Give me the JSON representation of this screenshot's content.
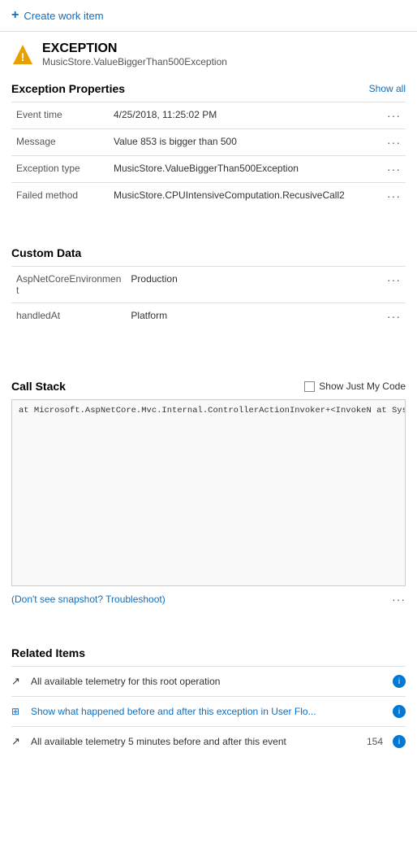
{
  "header": {
    "create_work_item_label": "Create work item",
    "plus_symbol": "+"
  },
  "exception": {
    "title": "EXCEPTION",
    "subtitle": "MusicStore.ValueBiggerThan500Exception"
  },
  "exception_properties": {
    "section_title": "Exception Properties",
    "show_all_label": "Show all",
    "rows": [
      {
        "name": "Event time",
        "value": "4/25/2018, 11:25:02 PM"
      },
      {
        "name": "Message",
        "value": "Value 853 is bigger than 500"
      },
      {
        "name": "Exception type",
        "value": "MusicStore.ValueBiggerThan500Exception"
      },
      {
        "name": "Failed method",
        "value": "MusicStore.CPUIntensiveComputation.RecusiveCall2"
      }
    ],
    "ellipsis": "···"
  },
  "custom_data": {
    "section_title": "Custom Data",
    "rows": [
      {
        "name": "AspNetCoreEnvironmen\nt",
        "value": "Production"
      },
      {
        "name": "handledAt",
        "value": "Platform"
      }
    ],
    "ellipsis": "···"
  },
  "call_stack": {
    "section_title": "Call Stack",
    "show_just_code_label": "Show Just My Code",
    "stack_text": "   at Microsoft.AspNetCore.Mvc.Internal.ControllerActionInvoker+<InvokeN\n   at System.Runtime.ExceptionServices.ExceptionDispatchInfo.Throw (Sys^\n   at System.Runtime.CompilerServices.TaskAwaiter.ThrowForNonSuccess (S\n   at Microsoft.AspNetCore.Mvc.Internal.ControllerActionInvoker+<Invoke\n   at System.Runtime.ExceptionServices.ExceptionDispatchInfo.Throw (Sys\n   at Microsoft.AspNetCore.Mvc.Internal.ControllerActionInvoker.Rethrow\n   at Microsoft.AspNetCore.Mvc.Internal.ControllerActionInvoker.Next (M\n   at Microsoft.AspNetCore.Mvc.Internal.ControllerActionInvoker+<Invoke\n   at System.Runtime.CompilerServices.TaskAwaiter.ThrowForNonSuccess (S\n   at Microsoft.AspNetCore.Mvc.Internal.ResourceInvoker+<InvokeNextResd\n   at System.Runtime.ExceptionServices.ExceptionDispatchInfo.Throw (Sys\n   at Microsoft.AspNetCore.Mvc.Internal.ResourceInvoker.Rethrow (Micros\n   at Microsoft.AspNetCore.Mvc.Internal.ResourceInvoker.Next (Microsoft\n   at Microsoft.AspNetCore.Mvc.Internal.ControllerActionInvoker+<InvokeFilterP:\n   at System.Runtime.ExceptionServices.ExceptionDispatchInfo.Throw (Sys\n   at System.Runtime.CompilerServices.TaskAwaiter.ThrowForNonSuccess (S"
  },
  "snapshot": {
    "link_text": "(Don't see snapshot? Troubleshoot)",
    "ellipsis": "···"
  },
  "related_items": {
    "section_title": "Related Items",
    "items": [
      {
        "icon": "↗",
        "label": "All available telemetry for this root operation",
        "count": null,
        "icon_type": "arrow"
      },
      {
        "icon": "⊞",
        "label": "Show what happened before and after this exception in User Flo...",
        "count": null,
        "icon_type": "grid",
        "blue": true
      },
      {
        "icon": "↗",
        "label": "All available telemetry 5 minutes before and after this event",
        "count": "154",
        "icon_type": "arrow"
      }
    ]
  }
}
